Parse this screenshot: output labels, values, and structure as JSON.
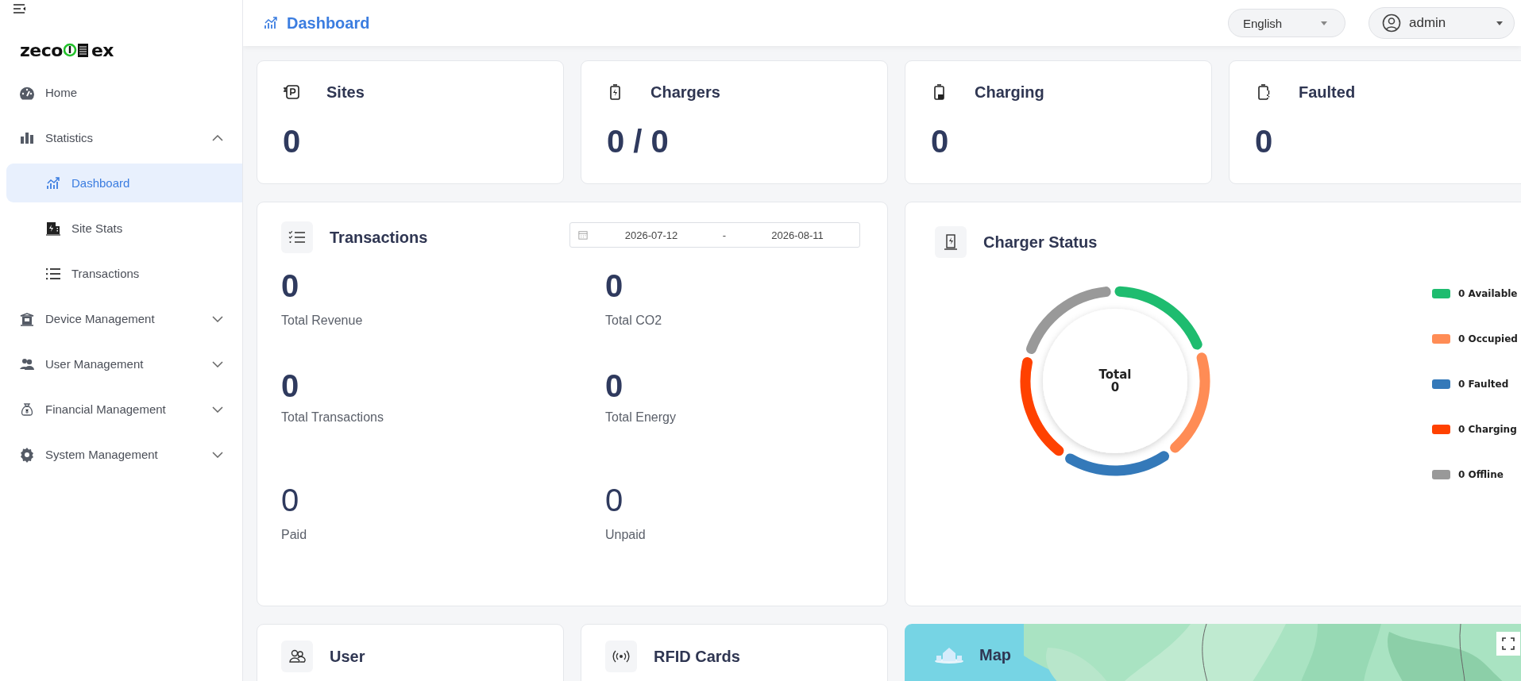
{
  "sidebar": {
    "logo": {
      "left": "zeco",
      "right": "ex"
    },
    "items": [
      {
        "label": "Home",
        "kind": "link",
        "selected": false
      },
      {
        "label": "Statistics",
        "kind": "group",
        "expanded": true,
        "selected": false,
        "children": [
          {
            "label": "Dashboard",
            "selected": true
          },
          {
            "label": "Site Stats",
            "selected": false
          },
          {
            "label": "Transactions",
            "selected": false
          }
        ]
      },
      {
        "label": "Device Management",
        "kind": "group",
        "expanded": false,
        "selected": false
      },
      {
        "label": "User Management",
        "kind": "group",
        "expanded": false,
        "selected": false
      },
      {
        "label": "Financial Management",
        "kind": "group",
        "expanded": false,
        "selected": false
      },
      {
        "label": "System Management",
        "kind": "group",
        "expanded": false,
        "selected": false
      }
    ]
  },
  "header": {
    "title": "Dashboard",
    "language": "English",
    "user": "admin"
  },
  "stat_cards": [
    {
      "title": "Sites",
      "value": "0"
    },
    {
      "title": "Chargers",
      "value": "0 / 0"
    },
    {
      "title": "Charging",
      "value": "0"
    },
    {
      "title": "Faulted",
      "value": "0"
    }
  ],
  "transactions": {
    "title": "Transactions",
    "date_range": {
      "start": "2026-07-12",
      "separator": "-",
      "end": "2026-08-11"
    },
    "metrics": [
      {
        "value": "0",
        "label": "Total Revenue",
        "kind": "total"
      },
      {
        "value": "0",
        "label": "Total CO2",
        "kind": "total"
      },
      {
        "value": "0",
        "label": "Total Transactions",
        "kind": "total"
      },
      {
        "value": "0",
        "label": "Total Energy",
        "kind": "total"
      },
      {
        "value": "0",
        "label": "Paid",
        "kind": "count"
      },
      {
        "value": "0",
        "label": "Unpaid",
        "kind": "count"
      }
    ]
  },
  "charger_status": {
    "title": "Charger Status",
    "center_label": "Total",
    "center_value": "0",
    "legend": [
      {
        "label": "0 Available",
        "color": "#1ebc6f"
      },
      {
        "label": "0 Occupied",
        "color": "#ff8c55"
      },
      {
        "label": "0 Faulted",
        "color": "#3479b9"
      },
      {
        "label": "0 Charging",
        "color": "#ff4100"
      },
      {
        "label": "0 Offline",
        "color": "#999999"
      }
    ]
  },
  "bottom_cards": [
    {
      "title": "User"
    },
    {
      "title": "RFID Cards"
    }
  ],
  "map": {
    "title": "Map",
    "kind": "picture"
  }
}
